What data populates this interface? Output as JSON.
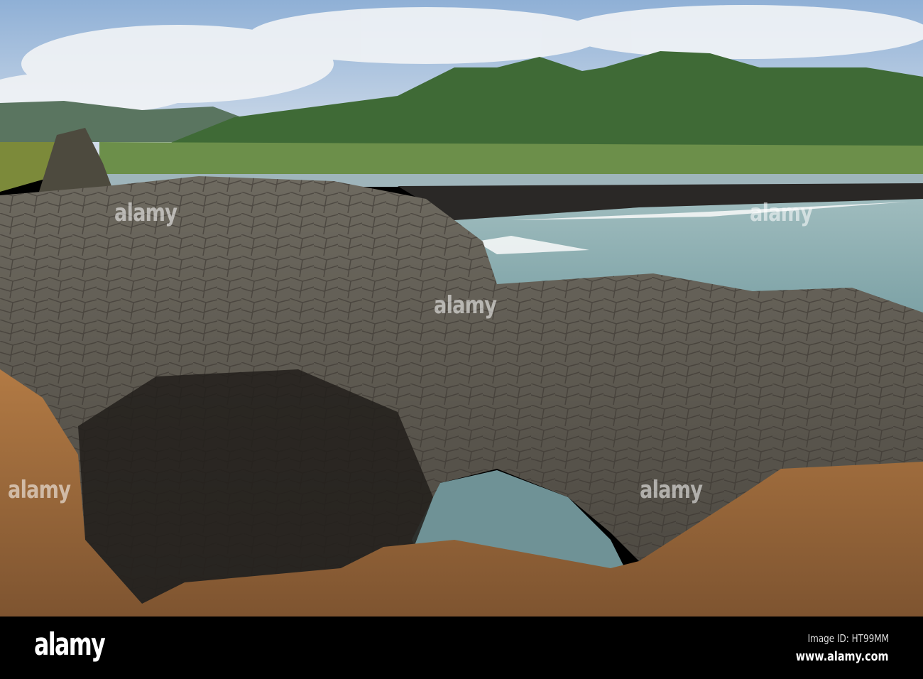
{
  "footer": {
    "logo": "alamy",
    "image_id": "Image ID: HT99MM",
    "website": "www.alamy.com"
  },
  "watermark": "alamy",
  "colors": {
    "sky": "#9fb7d2",
    "mountain": "#3f6a36",
    "sea": "#8aaeb0",
    "basalt": "#5e5a52",
    "sand_rock": "#a8703e"
  }
}
